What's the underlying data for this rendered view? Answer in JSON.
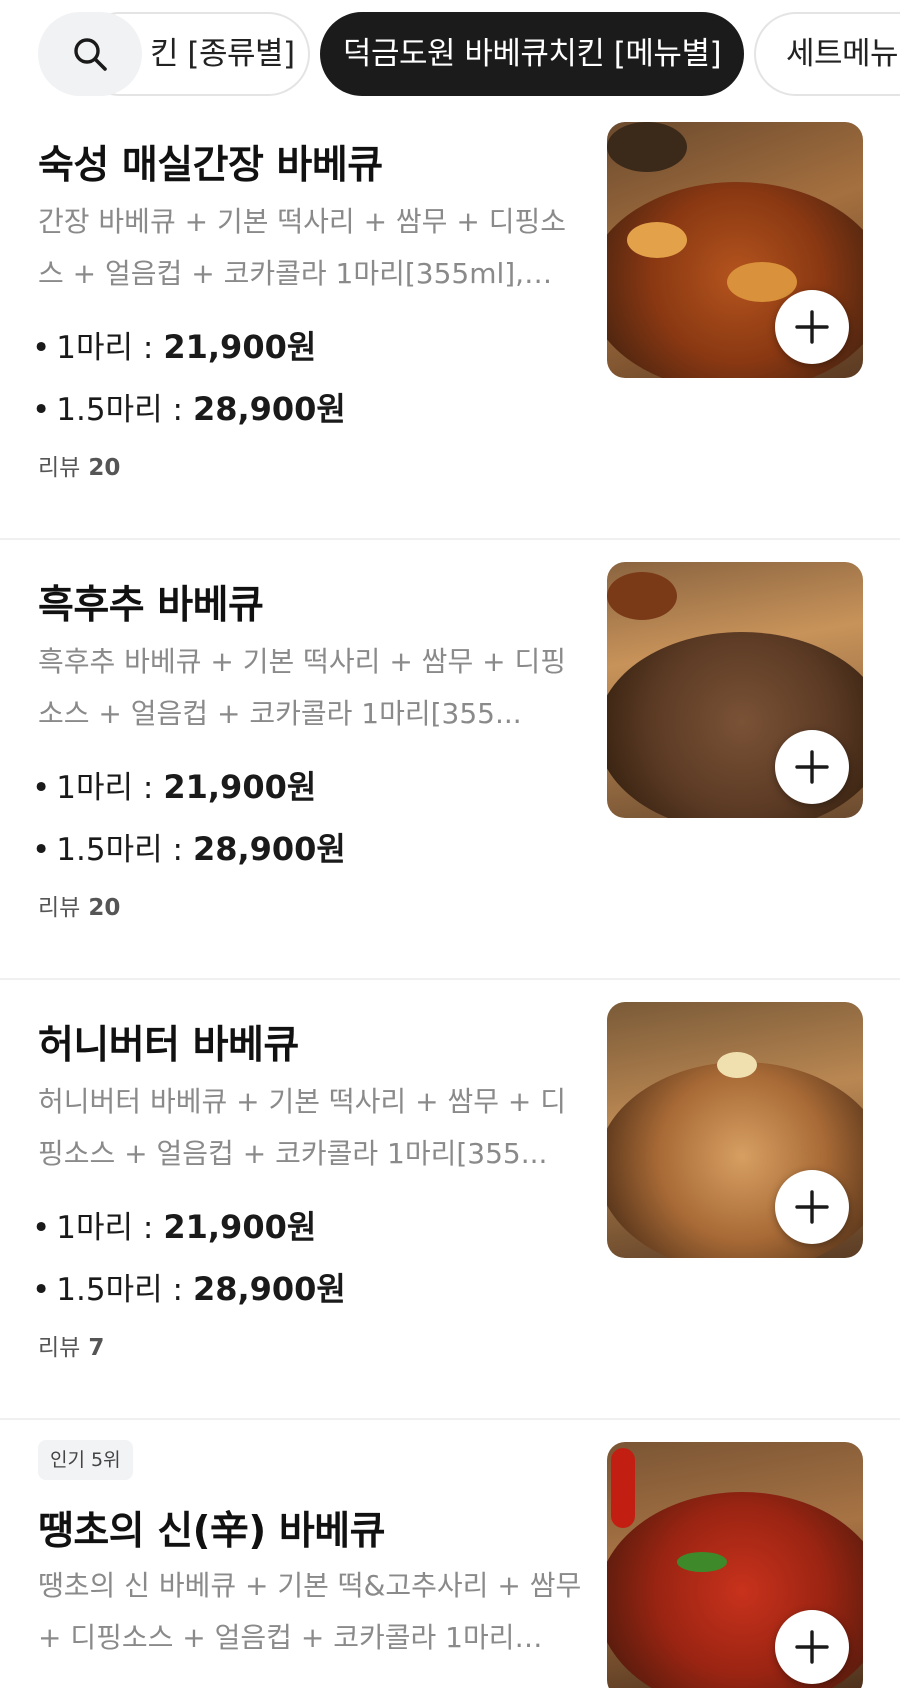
{
  "tabs": [
    {
      "label": "킨 [종류별]",
      "active": false
    },
    {
      "label": "덕금도원 바베큐치킨 [메뉴별]",
      "active": true
    },
    {
      "label": "세트메뉴",
      "active": false
    }
  ],
  "search": {
    "icon": "search-icon"
  },
  "accent_colors": {
    "active_tab": "#1b1b1b",
    "badge_bg": "#f2f3f5",
    "desc_text": "#8a8a8a"
  },
  "items": [
    {
      "title": "숙성 매실간장 바베큐",
      "desc": "간장 바베큐 + 기본 떡사리 + 쌈무 + 디핑소스 + 얼음컵 + 코카콜라 1마리[355ml], 1.5...",
      "prices": [
        {
          "label": "1마리 :",
          "amount": "21,900원"
        },
        {
          "label": "1.5마리 :",
          "amount": "28,900원"
        }
      ],
      "review_label": "리뷰",
      "review_count": "20",
      "image": "soy-garlic-bbq-chicken-photo"
    },
    {
      "title": "흑후추 바베큐",
      "desc": "흑후추 바베큐 + 기본 떡사리 + 쌈무 + 디핑소스 + 얼음컵 + 코카콜라 1마리[355...",
      "prices": [
        {
          "label": "1마리 :",
          "amount": "21,900원"
        },
        {
          "label": "1.5마리 :",
          "amount": "28,900원"
        }
      ],
      "review_label": "리뷰",
      "review_count": "20",
      "image": "black-pepper-bbq-chicken-photo"
    },
    {
      "title": "허니버터 바베큐",
      "desc": "허니버터 바베큐 + 기본 떡사리 + 쌈무 + 디핑소스 + 얼음컵 + 코카콜라 1마리[355...",
      "prices": [
        {
          "label": "1마리 :",
          "amount": "21,900원"
        },
        {
          "label": "1.5마리 :",
          "amount": "28,900원"
        }
      ],
      "review_label": "리뷰",
      "review_count": "7",
      "image": "honey-butter-bbq-chicken-photo"
    },
    {
      "badge": "인기 5위",
      "title": "땡초의 신(辛) 바베큐",
      "desc": "땡초의 신 바베큐 + 기본 떡&고추사리 + 쌈무 + 디핑소스 + 얼음컵 + 코카콜라 1마리[35...",
      "image": "spicy-pepper-bbq-chicken-photo"
    }
  ]
}
